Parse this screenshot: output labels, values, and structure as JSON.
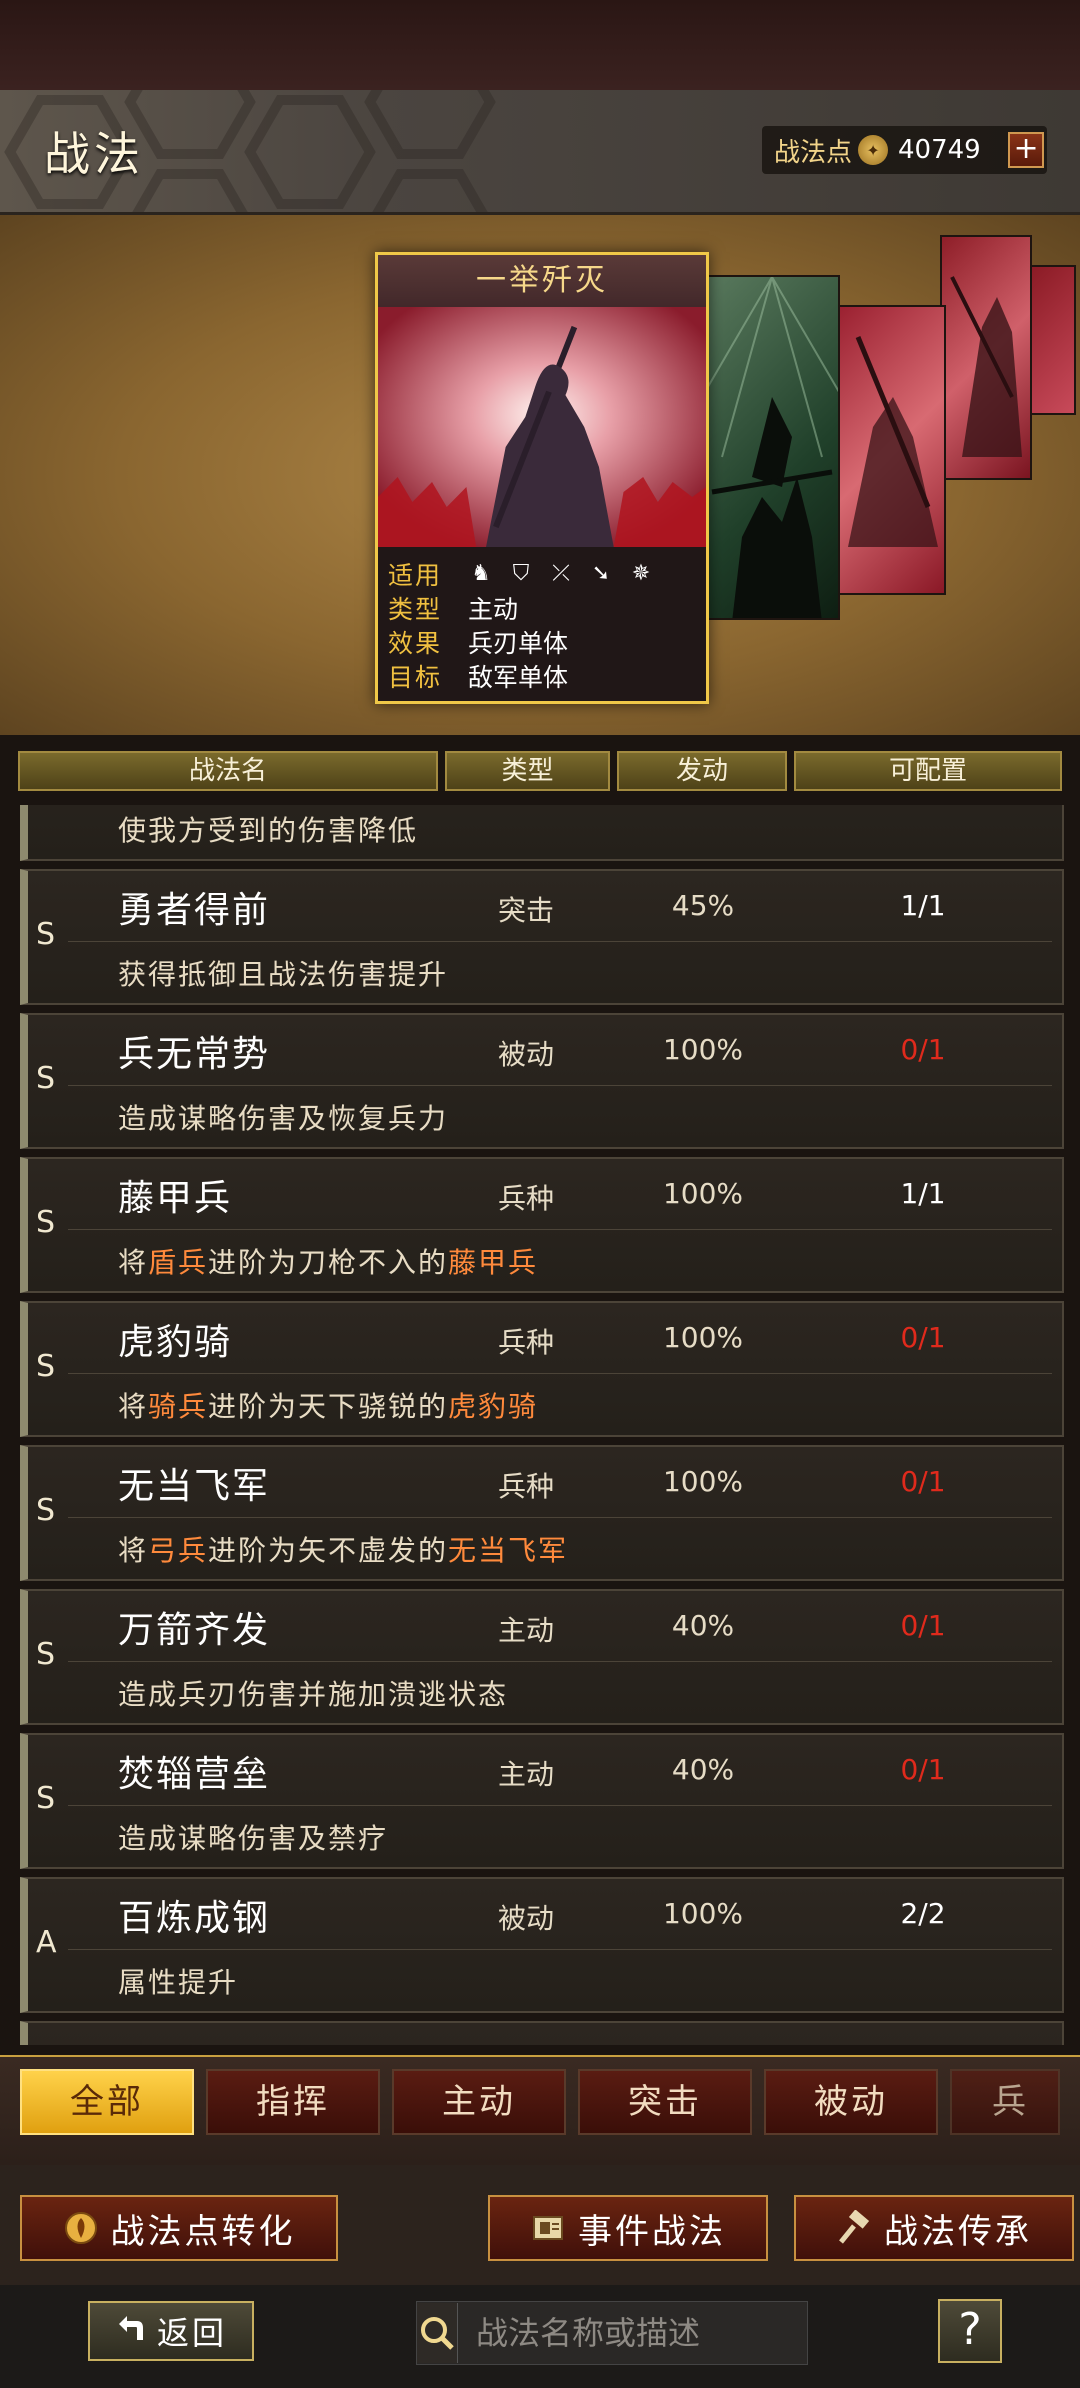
{
  "header": {
    "title": "战法",
    "points_label": "战法点",
    "points_value": "40749",
    "add_label": "+"
  },
  "featured": {
    "name": "一举歼灭",
    "rows": [
      {
        "key": "适用",
        "value": ""
      },
      {
        "key": "类型",
        "value": "主动"
      },
      {
        "key": "效果",
        "value": "兵刃单体"
      },
      {
        "key": "目标",
        "value": "敌军单体"
      }
    ],
    "unit_icons": [
      "cavalry-icon",
      "shield-icon",
      "bow-icon",
      "spear-icon",
      "wheel-icon"
    ]
  },
  "table": {
    "headers": [
      "战法名",
      "类型",
      "发动",
      "可配置"
    ],
    "partial_desc": "使我方受到的伤害降低",
    "rows": [
      {
        "grade": "S",
        "name": "勇者得前",
        "type": "突击",
        "rate": "45%",
        "config": "1/1",
        "config_full": false,
        "desc": "获得抵御且战法伤害提升"
      },
      {
        "grade": "S",
        "name": "兵无常势",
        "type": "被动",
        "rate": "100%",
        "config": "0/1",
        "config_full": true,
        "desc": "造成谋略伤害及恢复兵力"
      },
      {
        "grade": "S",
        "name": "藤甲兵",
        "type": "兵种",
        "rate": "100%",
        "config": "1/1",
        "config_full": false,
        "desc_parts": [
          "将",
          "盾兵",
          "进阶为刀枪不入的",
          "藤甲兵"
        ]
      },
      {
        "grade": "S",
        "name": "虎豹骑",
        "type": "兵种",
        "rate": "100%",
        "config": "0/1",
        "config_full": true,
        "desc_parts": [
          "将",
          "骑兵",
          "进阶为天下骁锐的",
          "虎豹骑"
        ]
      },
      {
        "grade": "S",
        "name": "无当飞军",
        "type": "兵种",
        "rate": "100%",
        "config": "0/1",
        "config_full": true,
        "desc_parts": [
          "将",
          "弓兵",
          "进阶为矢不虚发的",
          "无当飞军"
        ]
      },
      {
        "grade": "S",
        "name": "万箭齐发",
        "type": "主动",
        "rate": "40%",
        "config": "0/1",
        "config_full": true,
        "desc": "造成兵刃伤害并施加溃逃状态"
      },
      {
        "grade": "S",
        "name": "焚辎营垒",
        "type": "主动",
        "rate": "40%",
        "config": "0/1",
        "config_full": true,
        "desc": "造成谋略伤害及禁疗"
      },
      {
        "grade": "A",
        "name": "百炼成钢",
        "type": "被动",
        "rate": "100%",
        "config": "2/2",
        "config_full": false,
        "desc": "属性提升"
      }
    ]
  },
  "tabs": [
    "全部",
    "指挥",
    "主动",
    "突击",
    "被动",
    "兵种"
  ],
  "active_tab": "全部",
  "actions": {
    "convert": "战法点转化",
    "event": "事件战法",
    "inherit": "战法传承"
  },
  "bottom": {
    "back": "返回",
    "search_placeholder": "战法名称或描述",
    "help": "?"
  },
  "colors": {
    "accent_gold": "#f0c848",
    "full_red": "#e02a1c",
    "highlight_orange": "#ff8a3c"
  }
}
